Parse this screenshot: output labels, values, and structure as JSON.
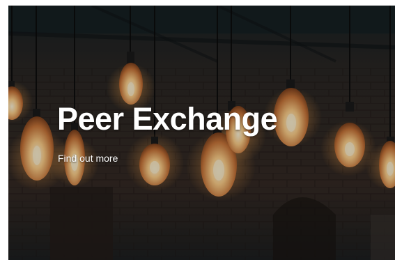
{
  "hero": {
    "title": "Peer Exchange",
    "link_label": "Find out more"
  },
  "colors": {
    "background_dark": "#1c1f22",
    "brick": "#3a2c24",
    "bulb_glow": "#ffd9a0",
    "bulb_core": "#fff4d6",
    "text": "#ffffff"
  },
  "image": {
    "subject": "hanging-edison-bulbs-icon"
  }
}
